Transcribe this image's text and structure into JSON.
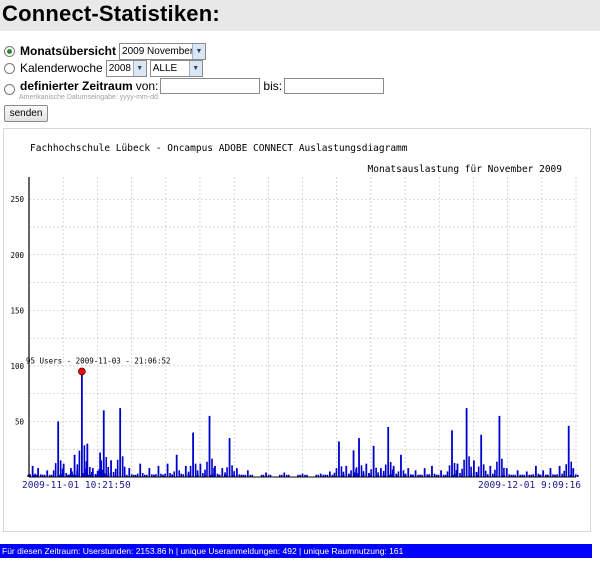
{
  "page": {
    "title": "Connect-Statistiken:"
  },
  "form": {
    "options": [
      {
        "label": "Monatsübersicht",
        "selected": true,
        "month_select": "2009 November"
      },
      {
        "label": "Kalenderwoche",
        "selected": false,
        "year_select": "2008",
        "week_select": "ALLE"
      },
      {
        "label": "definierter Zeitraum",
        "selected": false,
        "from_label": "von:",
        "to_label": "bis:",
        "from_value": "",
        "to_value": "",
        "hint": "Amerikanische Datumseingabe: yyyy-mm-dd"
      }
    ],
    "submit_label": "senden"
  },
  "chart": {
    "title": "Fachhochschule Lübeck - Oncampus  ADOBE CONNECT Auslastungsdiagramm",
    "subtitle": "Monatsauslastung für November 2009",
    "start_label": "2009-11-01  10:21:50",
    "end_label": "2009-12-01  9:09:16",
    "peak_label": "95 Users - 2009-11-03 - 21:06:52",
    "y_ticks": [
      "50",
      "100",
      "150",
      "200",
      "250"
    ],
    "series_color": "#0000cc",
    "peak_color": "#ff0000"
  },
  "chart_data": {
    "type": "area",
    "title": "Fachhochschule Lübeck - Oncampus  ADOBE CONNECT Auslastungsdiagramm",
    "subtitle": "Monatsauslastung für November 2009",
    "x_range": [
      "2009-11-01 10:21:50",
      "2009-12-01 9:09:16"
    ],
    "ylim": [
      0,
      270
    ],
    "y_ticks": [
      50,
      100,
      150,
      200,
      250
    ],
    "grid": true,
    "peak": {
      "value": 95,
      "time": "2009-11-03 21:06:52"
    },
    "spikes": [
      {
        "day": 0.2,
        "value": 10
      },
      {
        "day": 0.5,
        "value": 8
      },
      {
        "day": 1.0,
        "value": 6
      },
      {
        "day": 1.6,
        "value": 50
      },
      {
        "day": 1.9,
        "value": 12
      },
      {
        "day": 2.3,
        "value": 8
      },
      {
        "day": 2.5,
        "value": 20
      },
      {
        "day": 2.9,
        "value": 95
      },
      {
        "day": 3.2,
        "value": 30
      },
      {
        "day": 3.5,
        "value": 8
      },
      {
        "day": 3.9,
        "value": 22
      },
      {
        "day": 4.1,
        "value": 60
      },
      {
        "day": 4.5,
        "value": 15
      },
      {
        "day": 5.0,
        "value": 62
      },
      {
        "day": 5.5,
        "value": 8
      },
      {
        "day": 6.1,
        "value": 12
      },
      {
        "day": 6.6,
        "value": 8
      },
      {
        "day": 7.1,
        "value": 10
      },
      {
        "day": 7.6,
        "value": 12
      },
      {
        "day": 8.1,
        "value": 20
      },
      {
        "day": 8.6,
        "value": 10
      },
      {
        "day": 9.0,
        "value": 40
      },
      {
        "day": 9.4,
        "value": 12
      },
      {
        "day": 9.9,
        "value": 55
      },
      {
        "day": 10.2,
        "value": 10
      },
      {
        "day": 10.6,
        "value": 8
      },
      {
        "day": 11.0,
        "value": 35
      },
      {
        "day": 11.4,
        "value": 8
      },
      {
        "day": 12.0,
        "value": 6
      },
      {
        "day": 13.0,
        "value": 4
      },
      {
        "day": 14.0,
        "value": 4
      },
      {
        "day": 15.0,
        "value": 3
      },
      {
        "day": 16.0,
        "value": 3
      },
      {
        "day": 16.5,
        "value": 5
      },
      {
        "day": 17.0,
        "value": 32
      },
      {
        "day": 17.4,
        "value": 10
      },
      {
        "day": 17.8,
        "value": 24
      },
      {
        "day": 18.1,
        "value": 35
      },
      {
        "day": 18.5,
        "value": 12
      },
      {
        "day": 18.9,
        "value": 28
      },
      {
        "day": 19.3,
        "value": 8
      },
      {
        "day": 19.7,
        "value": 45
      },
      {
        "day": 20.0,
        "value": 10
      },
      {
        "day": 20.4,
        "value": 20
      },
      {
        "day": 20.8,
        "value": 8
      },
      {
        "day": 21.2,
        "value": 6
      },
      {
        "day": 21.7,
        "value": 8
      },
      {
        "day": 22.1,
        "value": 10
      },
      {
        "day": 22.6,
        "value": 6
      },
      {
        "day": 23.2,
        "value": 42
      },
      {
        "day": 23.5,
        "value": 12
      },
      {
        "day": 24.0,
        "value": 62
      },
      {
        "day": 24.4,
        "value": 15
      },
      {
        "day": 24.8,
        "value": 38
      },
      {
        "day": 25.3,
        "value": 10
      },
      {
        "day": 25.8,
        "value": 55
      },
      {
        "day": 26.2,
        "value": 8
      },
      {
        "day": 26.8,
        "value": 6
      },
      {
        "day": 27.3,
        "value": 5
      },
      {
        "day": 27.8,
        "value": 10
      },
      {
        "day": 28.2,
        "value": 6
      },
      {
        "day": 28.6,
        "value": 8
      },
      {
        "day": 29.1,
        "value": 10
      },
      {
        "day": 29.6,
        "value": 46
      },
      {
        "day": 29.85,
        "value": 8
      }
    ]
  },
  "footer": {
    "text": "Für diesen Zeitraum: Userstunden: 2153.86 h | unique Useranmeldungen: 492 | unique Raumnutzung: 161"
  }
}
